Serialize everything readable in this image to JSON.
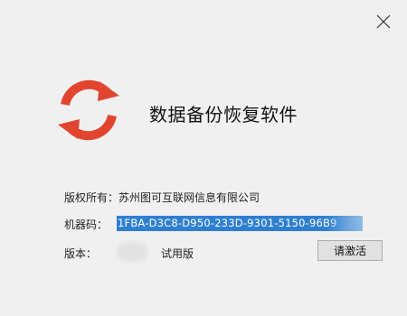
{
  "dialog": {
    "close_icon": "close-icon",
    "logo_icon": "sync-refresh-icon",
    "logo_color": "#e2452f",
    "app_title": "数据备份恢复软件"
  },
  "info": {
    "copyright_label": "版权所有：",
    "copyright_value": "苏州图可互联网信息有限公司",
    "machine_label": "机器码：",
    "machine_code": "1FBA-D3C8-D950-233D-9301-5150-96B9",
    "version_label": "版本：",
    "version_value": "试用版"
  },
  "buttons": {
    "activate_label": "请激活"
  },
  "colors": {
    "background": "#f0f0f0",
    "selection_highlight": "#2f7fd0",
    "button_face": "#e1e1e1",
    "button_border": "#adadad"
  }
}
